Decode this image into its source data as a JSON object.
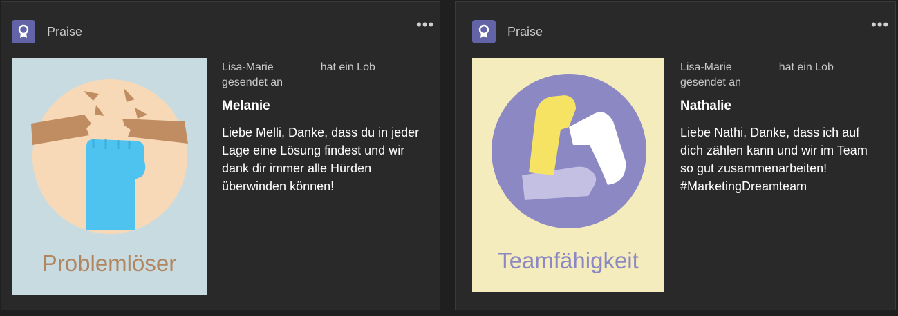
{
  "cards": [
    {
      "app_name": "Praise",
      "more_label": "•••",
      "sender_name": "Lisa-Marie",
      "sender_action": "hat ein Lob",
      "sender_suffix": "gesendet an",
      "recipient": "Melanie",
      "message": "Liebe Melli, Danke, dass du in jeder Lage eine Lösung findest und wir dank dir immer alle Hürden überwinden können!",
      "badge": {
        "label": "Problemlöser",
        "background": "#c8dbe0",
        "circle": "#f7d9b7",
        "label_color": "#b08560",
        "icon": "broken-barrier-fist-icon"
      }
    },
    {
      "app_name": "Praise",
      "more_label": "•••",
      "sender_name": "Lisa-Marie",
      "sender_action": "hat ein Lob",
      "sender_suffix": "gesendet an",
      "recipient": "Nathalie",
      "message": "Liebe Nathi, Danke, dass ich auf dich zählen kann und wir im Team so gut zusammenarbeiten! #MarketingDreamteam",
      "badge": {
        "label": "Teamfähigkeit",
        "background": "#f4ecbc",
        "circle": "#8b88c4",
        "label_color": "#8b88c4",
        "icon": "clasped-hands-icon"
      }
    }
  ],
  "colors": {
    "card_bg": "#292929",
    "app_icon_bg": "#6264a7",
    "page_bg": "#1f1f1f"
  }
}
